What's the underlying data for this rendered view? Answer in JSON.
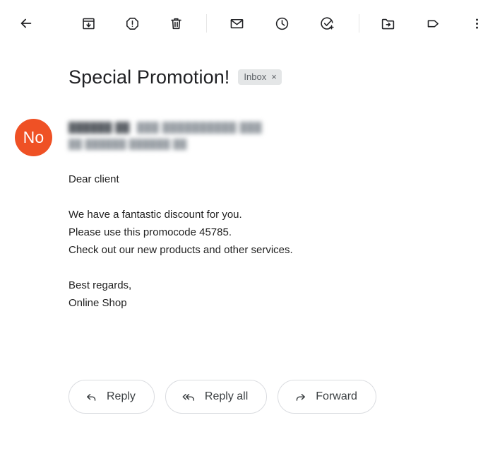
{
  "toolbar": {
    "back": {
      "label": "Back",
      "icon": "arrow-left-icon"
    },
    "items": [
      {
        "name": "archive-button",
        "icon": "archive-icon",
        "tooltip": "Archive"
      },
      {
        "name": "report-spam-button",
        "icon": "report-spam-icon",
        "tooltip": "Report spam"
      },
      {
        "name": "delete-button",
        "icon": "trash-icon",
        "tooltip": "Delete"
      },
      {
        "name": "mark-unread-button",
        "icon": "envelope-icon",
        "tooltip": "Mark as unread"
      },
      {
        "name": "snooze-button",
        "icon": "clock-icon",
        "tooltip": "Snooze"
      },
      {
        "name": "add-to-tasks-button",
        "icon": "check-circle-plus-icon",
        "tooltip": "Add to tasks"
      },
      {
        "name": "move-to-button",
        "icon": "folder-move-icon",
        "tooltip": "Move to"
      },
      {
        "name": "labels-button",
        "icon": "label-tag-icon",
        "tooltip": "Labels"
      },
      {
        "name": "more-options-button",
        "icon": "kebab-menu-icon",
        "tooltip": "More"
      }
    ]
  },
  "email": {
    "subject": "Special Promotion!",
    "label_chip": {
      "text": "Inbox",
      "remove": "×"
    },
    "avatar": {
      "initials": "No",
      "color": "#ef5125"
    },
    "sender_name_redacted": "██████ ██",
    "sender_email_redacted": "███ ██████████ ███",
    "recipient_redacted": "██ ██████ ██████ ██",
    "body": {
      "greeting": "Dear client",
      "line1": "We have a fantastic discount for you.",
      "line2": "Please use this promocode 45785.",
      "line3": "Check out our new products and other services.",
      "signoff": "Best regards,",
      "signature": "Online Shop"
    }
  },
  "actions": {
    "reply": {
      "label": "Reply",
      "icon": "reply-arrow-icon"
    },
    "reply_all": {
      "label": "Reply all",
      "icon": "reply-all-arrow-icon"
    },
    "forward": {
      "label": "Forward",
      "icon": "forward-arrow-icon"
    }
  },
  "colors": {
    "accent_avatar": "#ef5125",
    "chip_bg": "#e4e6e7",
    "text_primary": "#202124",
    "text_secondary": "#5f6368",
    "border": "#dadce0"
  }
}
